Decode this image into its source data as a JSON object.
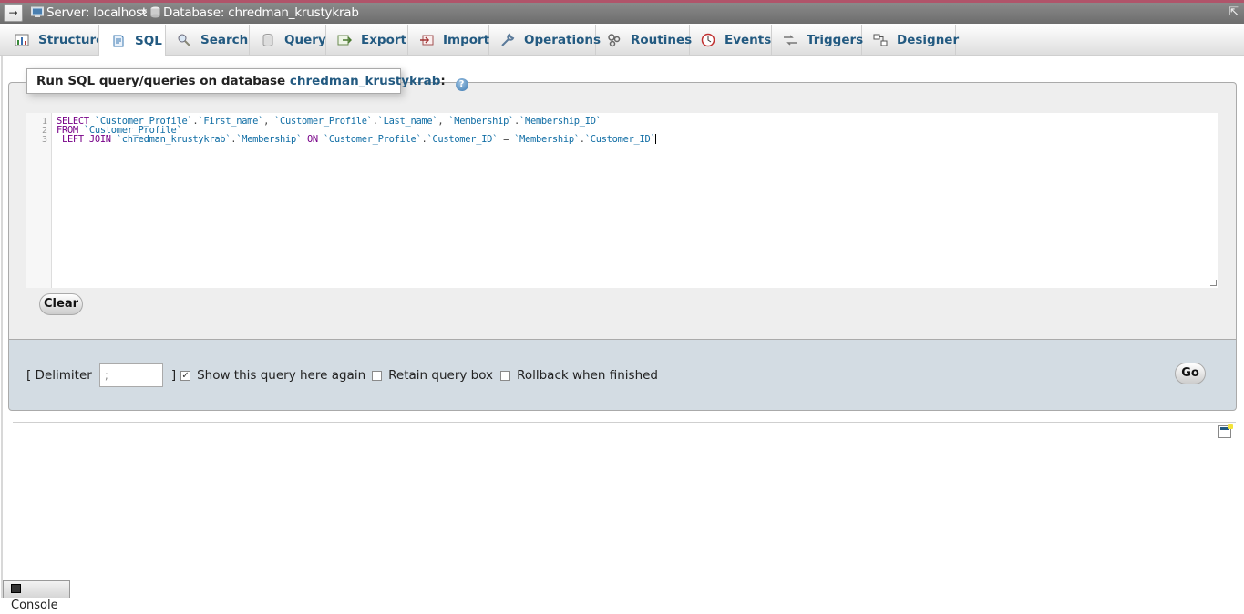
{
  "breadcrumb": {
    "server_label": "Server: localhost",
    "separator": "»",
    "database_label": "Database: chredman_krustykrab"
  },
  "tabs": [
    {
      "label": "Structure",
      "icon": "structure-icon",
      "active": false
    },
    {
      "label": "SQL",
      "icon": "sql-icon",
      "active": true
    },
    {
      "label": "Search",
      "icon": "search-icon",
      "active": false
    },
    {
      "label": "Query",
      "icon": "query-icon",
      "active": false
    },
    {
      "label": "Export",
      "icon": "export-icon",
      "active": false
    },
    {
      "label": "Import",
      "icon": "import-icon",
      "active": false
    },
    {
      "label": "Operations",
      "icon": "wrench-icon",
      "active": false
    },
    {
      "label": "Routines",
      "icon": "routines-icon",
      "active": false
    },
    {
      "label": "Events",
      "icon": "clock-icon",
      "active": false
    },
    {
      "label": "Triggers",
      "icon": "triggers-icon",
      "active": false
    },
    {
      "label": "Designer",
      "icon": "designer-icon",
      "active": false
    }
  ],
  "sql_panel": {
    "legend_prefix": "Run SQL query/queries on database",
    "database": "chredman_krustykrab",
    "legend_suffix": ":",
    "line_numbers": [
      "1",
      "2",
      "3"
    ],
    "query_lines": [
      "SELECT `Customer_Profile`.`First_name`, `Customer_Profile`.`Last_name`, `Membership`.`Membership_ID`",
      "FROM `Customer_Profile`",
      " LEFT JOIN `chredman_krustykrab`.`Membership` ON `Customer_Profile`.`Customer_ID` = `Membership`.`Customer_ID`"
    ],
    "clear_label": "Clear"
  },
  "options": {
    "delimiter_open": "[ Delimiter",
    "delimiter_value": ";",
    "delimiter_close": "]",
    "show_query_label": "Show this query here again",
    "show_query_checked": true,
    "retain_box_label": "Retain query box",
    "retain_box_checked": false,
    "rollback_label": "Rollback when finished",
    "rollback_checked": false,
    "go_label": "Go"
  },
  "console": {
    "label": "Console"
  },
  "colors": {
    "accent": "#b0546a",
    "link": "#235a81",
    "panel_bg": "#eeeeee",
    "options_bg": "#d3dce3"
  }
}
